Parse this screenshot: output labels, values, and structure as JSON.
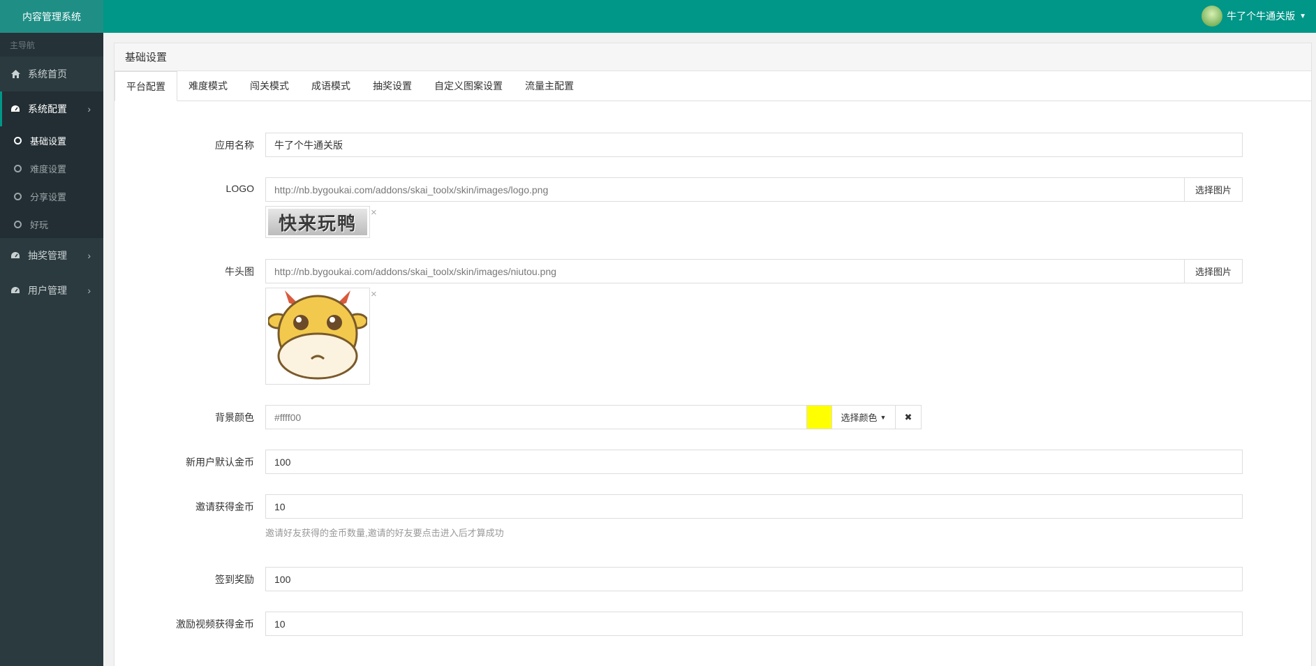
{
  "app": {
    "title": "内容管理系统"
  },
  "sidebar": {
    "section_label": "主导航",
    "items": [
      {
        "label": "系统首页",
        "icon": "home-icon"
      },
      {
        "label": "系统配置",
        "icon": "dashboard-icon",
        "active": true
      },
      {
        "label": "抽奖管理",
        "icon": "dashboard-icon"
      },
      {
        "label": "用户管理",
        "icon": "dashboard-icon"
      }
    ],
    "sub_items": [
      {
        "label": "基础设置",
        "active": true
      },
      {
        "label": "难度设置"
      },
      {
        "label": "分享设置"
      },
      {
        "label": "好玩"
      }
    ]
  },
  "header": {
    "username": "牛了个牛通关版"
  },
  "panel": {
    "title": "基础设置",
    "tabs": [
      "平台配置",
      "难度模式",
      "闯关模式",
      "成语模式",
      "抽奖设置",
      "自定义图案设置",
      "流量主配置"
    ]
  },
  "form": {
    "app_name": {
      "label": "应用名称",
      "value": "牛了个牛通关版"
    },
    "logo": {
      "label": "LOGO",
      "value": "http://nb.bygoukai.com/addons/skai_toolx/skin/images/logo.png",
      "button": "选择图片",
      "image_text": "快来玩鸭"
    },
    "niutou": {
      "label": "牛头图",
      "value": "http://nb.bygoukai.com/addons/skai_toolx/skin/images/niutou.png",
      "button": "选择图片"
    },
    "bg_color": {
      "label": "背景颜色",
      "value": "#ffff00",
      "display": "#ffff00",
      "swatch": "#ffff00",
      "button": "选择颜色"
    },
    "new_user_coins": {
      "label": "新用户默认金币",
      "value": "100"
    },
    "invite_coins": {
      "label": "邀请获得金币",
      "value": "10",
      "help": "邀请好友获得的金币数量,邀请的好友要点击进入后才算成功"
    },
    "checkin_reward": {
      "label": "签到奖励",
      "value": "100"
    },
    "video_coins": {
      "label": "激励视频获得金币",
      "value": "10"
    }
  },
  "colors": {
    "brand": "#009688",
    "sidebar": "#2b3a3f"
  }
}
